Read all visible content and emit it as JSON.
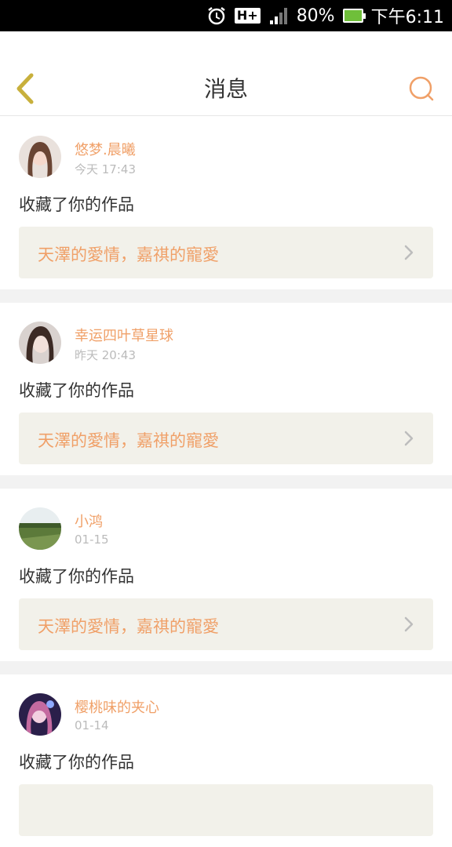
{
  "status_bar": {
    "icons": [
      "alarm-icon",
      "network-hplus-icon",
      "signal-icon",
      "battery-charging-icon"
    ],
    "network": "H+",
    "battery": "80%",
    "time": "下午6:11"
  },
  "header": {
    "title": "消息",
    "back_icon": "chevron-left-icon",
    "search_icon": "search-icon"
  },
  "colors": {
    "accent": "#f0a068",
    "back_icon": "#c8b03c",
    "card_bg": "#f2f1ea"
  },
  "messages": [
    {
      "user": "悠梦.晨曦",
      "time": "今天 17:43",
      "action": "收藏了你的作品",
      "work": "天澤的愛情，嘉祺的寵愛"
    },
    {
      "user": "幸运四叶草星球",
      "time": "昨天 20:43",
      "action": "收藏了你的作品",
      "work": "天澤的愛情，嘉祺的寵愛"
    },
    {
      "user": "小鸿",
      "time": "01-15",
      "action": "收藏了你的作品",
      "work": "天澤的愛情，嘉祺的寵愛"
    },
    {
      "user": "樱桃味的夹心",
      "time": "01-14",
      "action": "收藏了你的作品",
      "work": ""
    }
  ]
}
